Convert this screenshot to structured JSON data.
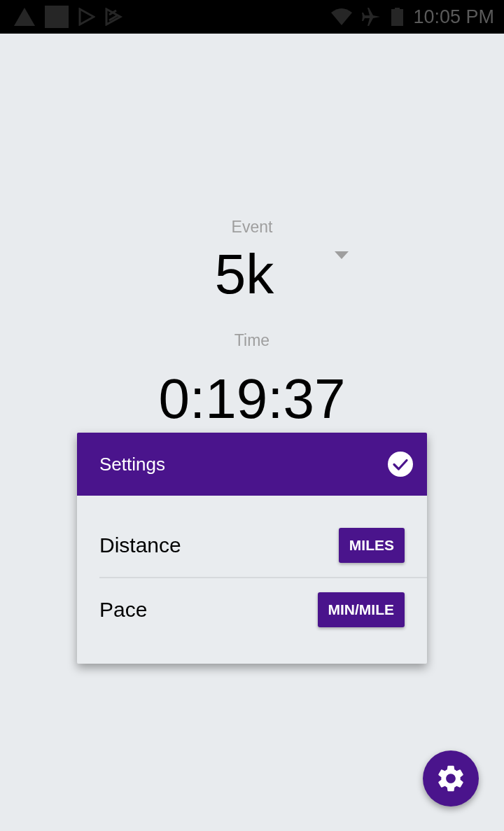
{
  "status_bar": {
    "time": "10:05 PM"
  },
  "event": {
    "label": "Event",
    "value": "5k"
  },
  "time": {
    "label": "Time",
    "value": "0:19:37"
  },
  "settings_dialog": {
    "title": "Settings",
    "rows": [
      {
        "label": "Distance",
        "button": "MILES"
      },
      {
        "label": "Pace",
        "button": "MIN/MILE"
      }
    ]
  }
}
